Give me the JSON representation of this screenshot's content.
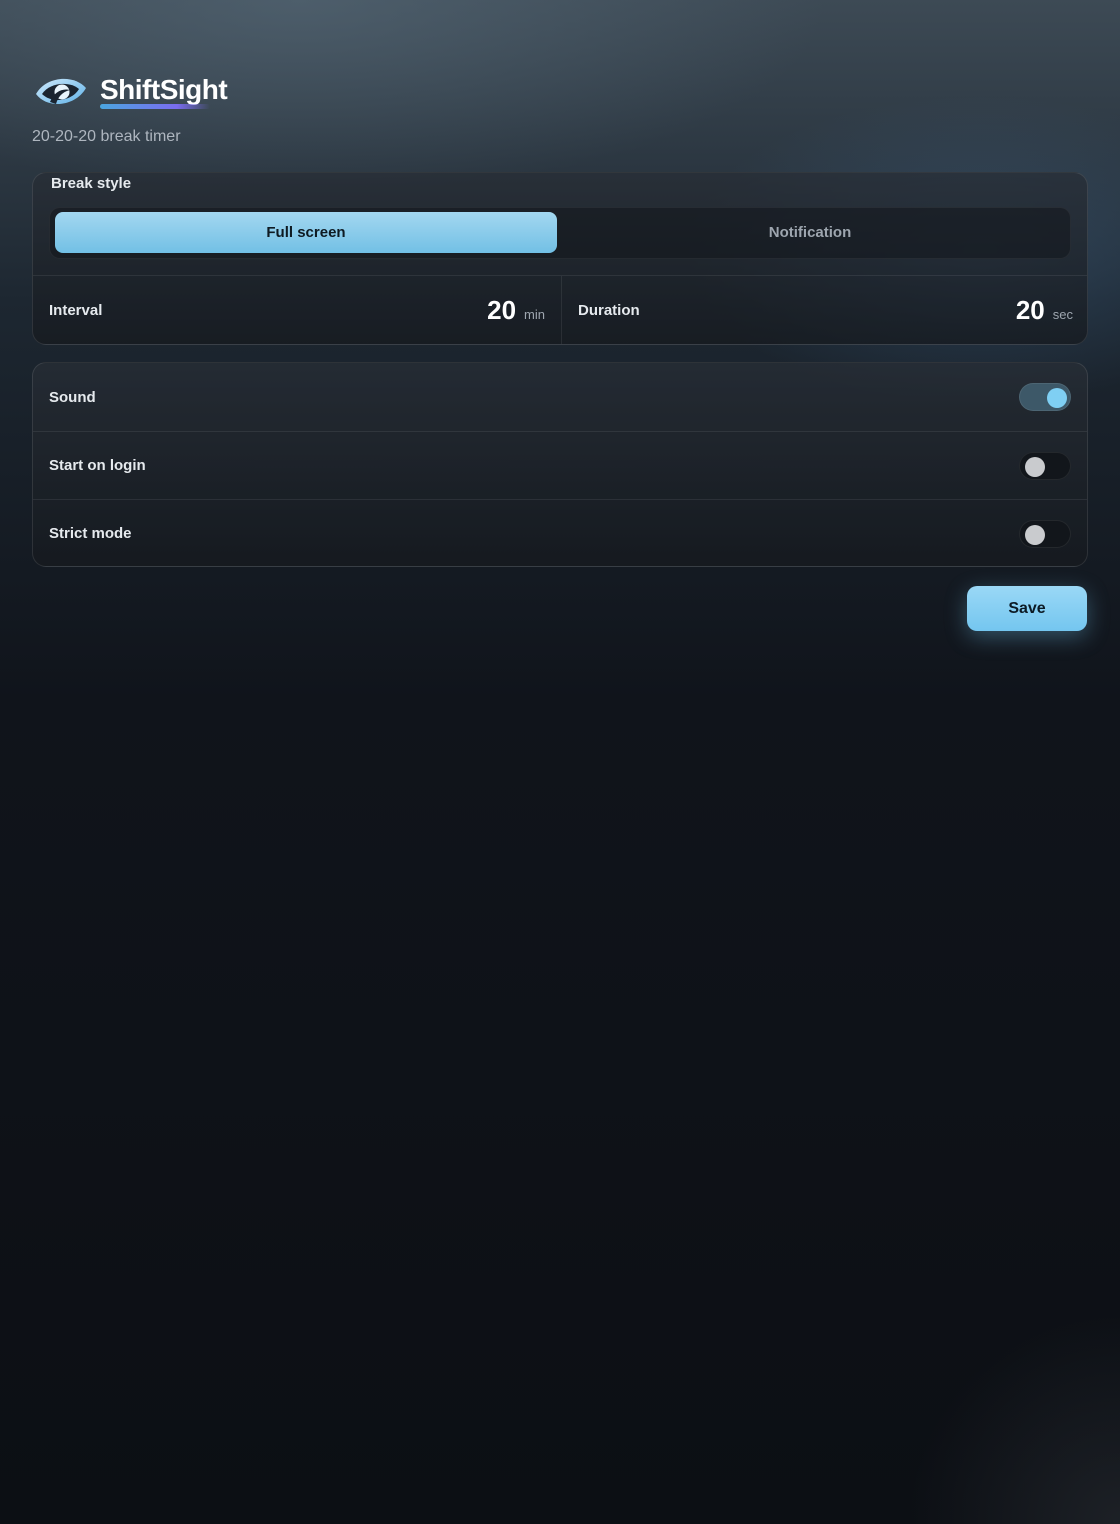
{
  "app": {
    "name": "ShiftSight",
    "subtitle": "20-20-20 break timer",
    "logo_icon": "eye-icon"
  },
  "break_style": {
    "label": "Break style",
    "options": [
      {
        "label": "Full screen",
        "selected": true
      },
      {
        "label": "Notification",
        "selected": false
      }
    ]
  },
  "metrics": {
    "interval": {
      "label": "Interval",
      "value": "20",
      "unit": "min"
    },
    "duration": {
      "label": "Duration",
      "value": "20",
      "unit": "sec"
    }
  },
  "toggles": [
    {
      "label": "Sound",
      "on": true
    },
    {
      "label": "Start on login",
      "on": false
    },
    {
      "label": "Strict mode",
      "on": false
    }
  ],
  "actions": {
    "save_label": "Save"
  },
  "colors": {
    "accent": "#74c6ef",
    "toggle_on_track": "#3d5868",
    "toggle_off_track": "#12161b"
  }
}
